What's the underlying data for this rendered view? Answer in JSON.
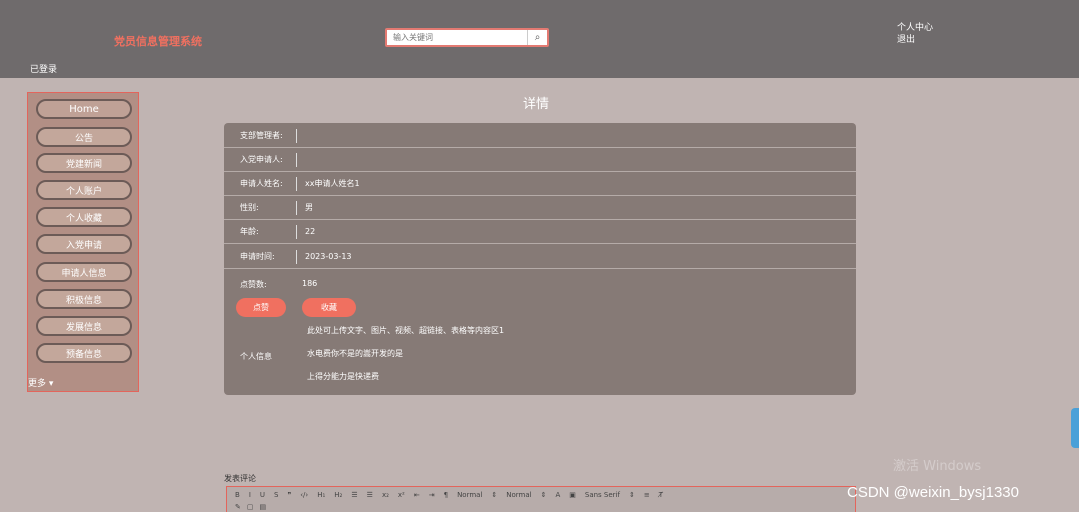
{
  "header": {
    "logo": "党员信息管理系统",
    "user_label": "已登录",
    "search_placeholder": "输入关键词",
    "search_icon": "search-icon",
    "links": [
      "个人中心",
      "退出"
    ]
  },
  "sidebar": {
    "items": [
      "Home",
      "公告",
      "党建新闻",
      "个人账户",
      "个人收藏",
      "入党申请",
      "申请人信息",
      "积极信息",
      "发展信息",
      "预备信息"
    ],
    "more": "更多"
  },
  "detail": {
    "title": "详情",
    "fields": [
      {
        "label": "支部管理者:",
        "value": ""
      },
      {
        "label": "入党申请人:",
        "value": ""
      },
      {
        "label": "申请人姓名:",
        "value": "xx申请人姓名1"
      },
      {
        "label": "性别:",
        "value": "男"
      },
      {
        "label": "年龄:",
        "value": "22"
      },
      {
        "label": "申请时间:",
        "value": "2023-03-13"
      }
    ],
    "likes_label": "点赞数:",
    "likes_value": "186",
    "like_button": "点赞",
    "favorite_button": "收藏",
    "info_label": "个人信息",
    "info_lines": [
      "此处可上传文字、图片、视频、超链接、表格等内容区1",
      "水电费你不是的嵩开发的是",
      "上得分能力是快递费"
    ]
  },
  "comment": {
    "title": "发表评论",
    "toolbar": [
      "B",
      "I",
      "U",
      "S",
      "❞",
      "‹/›",
      "H₁",
      "H₂",
      "☰",
      "☰",
      "x₂",
      "x²",
      "⇤",
      "⇥",
      "¶",
      "Normal",
      "⇕",
      "Normal",
      "⇕",
      "A",
      "▣",
      "Sans Serif",
      "⇕",
      "≡",
      "T̸"
    ],
    "toolbar2": [
      "✎",
      "▢",
      "▤"
    ]
  },
  "overlay": {
    "watermark": "激活 Windows",
    "csdn": "CSDN @weixin_bysj1330"
  },
  "colors": {
    "header_bg": "#6f6b6c",
    "page_bg": "#c0b4b2",
    "accent": "#f07060",
    "card_bg": "#867a76"
  }
}
